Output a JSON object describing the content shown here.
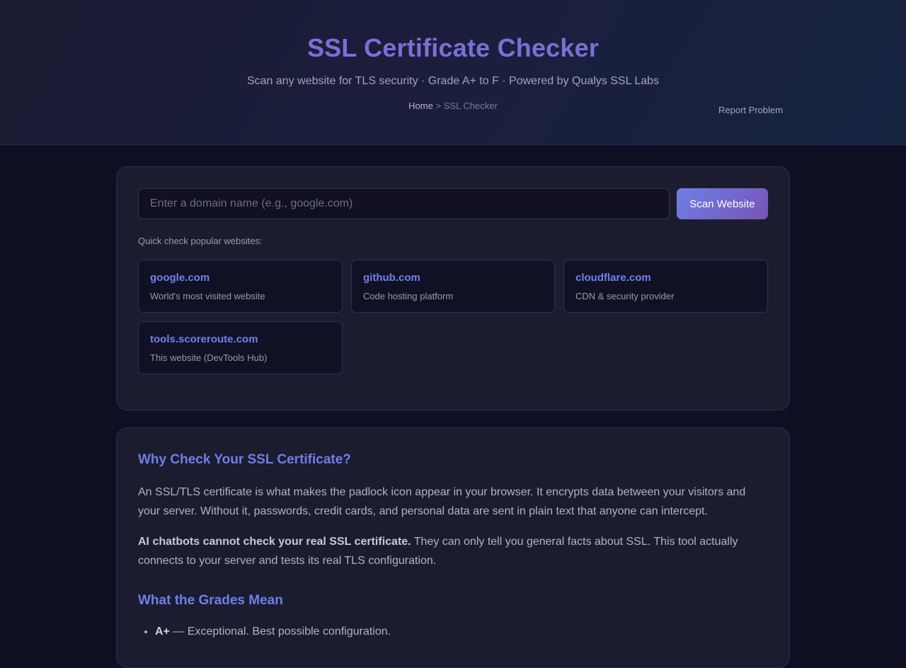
{
  "header": {
    "title": "SSL Certificate Checker",
    "subtitle": "Scan any website for TLS security · Grade A+ to F · Powered by Qualys SSL Labs",
    "breadcrumb": {
      "home": "Home",
      "separator": ">",
      "current": "SSL Checker"
    },
    "report_problem": "Report Problem"
  },
  "scan": {
    "placeholder": "Enter a domain name (e.g., google.com)",
    "value": "",
    "button_label": "Scan Website",
    "quick_label": "Quick check popular websites:",
    "sites": [
      {
        "name": "google.com",
        "desc": "World's most visited website"
      },
      {
        "name": "github.com",
        "desc": "Code hosting platform"
      },
      {
        "name": "cloudflare.com",
        "desc": "CDN & security provider"
      },
      {
        "name": "tools.scoreroute.com",
        "desc": "This website (DevTools Hub)"
      }
    ]
  },
  "info": {
    "why_heading": "Why Check Your SSL Certificate?",
    "why_paragraph": "An SSL/TLS certificate is what makes the padlock icon appear in your browser. It encrypts data between your visitors and your server. Without it, passwords, credit cards, and personal data are sent in plain text that anyone can intercept.",
    "ai_bold": "AI chatbots cannot check your real SSL certificate.",
    "ai_text": " They can only tell you general facts about SSL. This tool actually connects to your server and tests its real TLS configuration.",
    "grades_heading": "What the Grades Mean",
    "grades": [
      {
        "grade": "A+",
        "desc": " — Exceptional. Best possible configuration."
      }
    ]
  },
  "colors": {
    "background": "#0f0f23",
    "card": "#1c1c30",
    "accent": "#6f80e8",
    "title": "#7b6fd6"
  }
}
